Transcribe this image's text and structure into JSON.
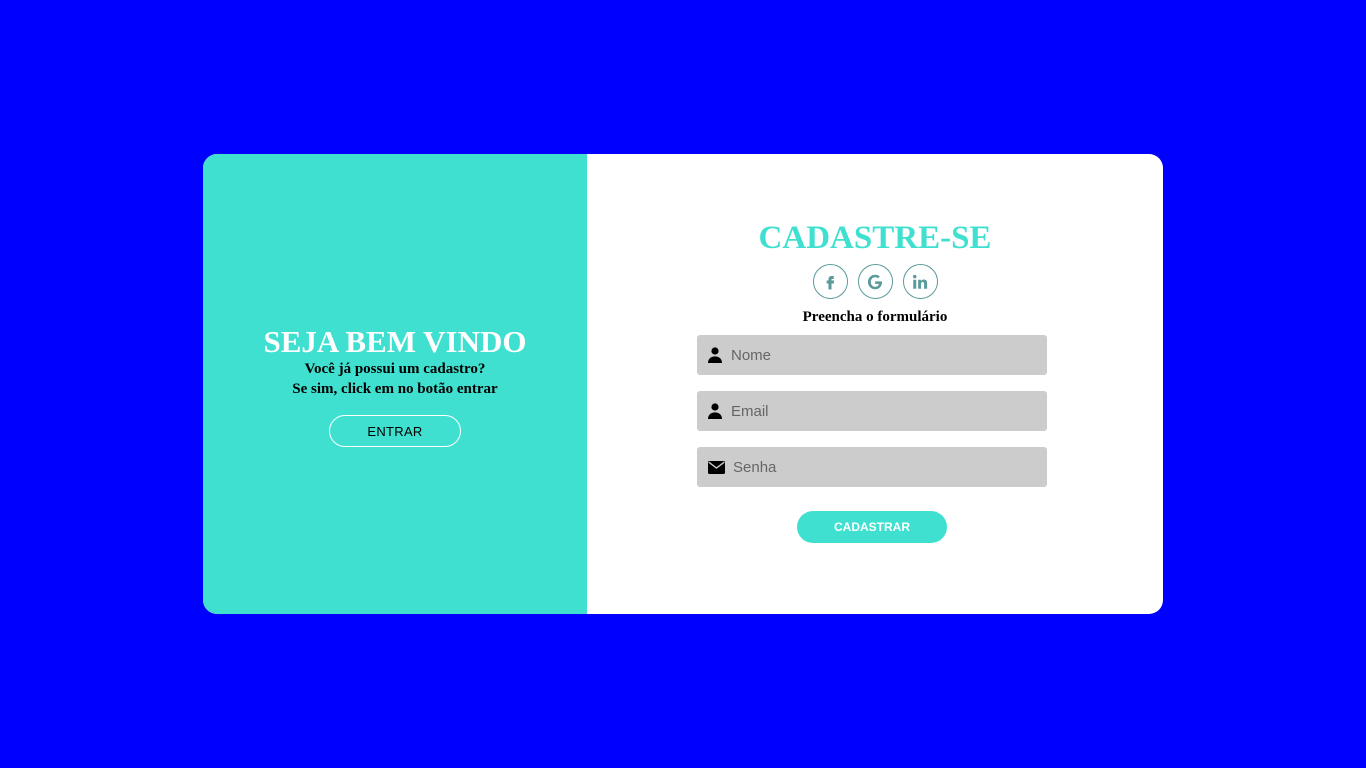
{
  "colors": {
    "background": "#0000ff",
    "accent": "#40e0d0",
    "card": "#ffffff",
    "field": "#cccccc",
    "social_border": "#5a9a9a"
  },
  "welcome": {
    "title": "SEJA BEM VINDO",
    "line1": "Você já possui um cadastro?",
    "line2": "Se sim, click em no botão entrar",
    "enter_label": "ENTRAR"
  },
  "signup": {
    "title": "CADASTRE-SE",
    "social": [
      {
        "icon": "facebook-icon"
      },
      {
        "icon": "google-icon"
      },
      {
        "icon": "linkedin-icon"
      }
    ],
    "hint": "Preencha o formulário",
    "fields": {
      "name": {
        "placeholder": "Nome",
        "value": "",
        "icon": "user-icon"
      },
      "email": {
        "placeholder": "Email",
        "value": "",
        "icon": "user-icon"
      },
      "password": {
        "placeholder": "Senha",
        "value": "",
        "icon": "envelope-icon"
      }
    },
    "submit_label": "CADASTRAR"
  }
}
